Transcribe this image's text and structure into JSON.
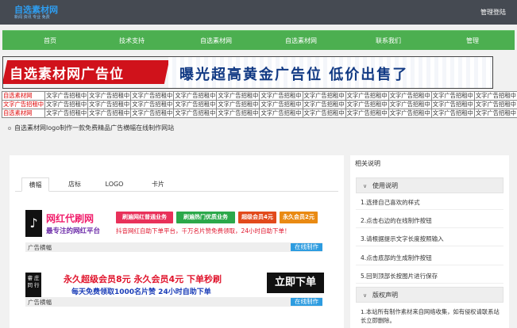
{
  "header": {
    "logo_main": "自选素材网",
    "logo_sub": "新闻 资讯 专业 免费",
    "login": "管理登陆"
  },
  "nav": {
    "items": [
      "首页",
      "技术支持",
      "自选素材网",
      "自选素材网",
      "联系我们",
      "管理"
    ]
  },
  "banner": {
    "left": "自选素材网广告位",
    "right": "曝光超高黄金广告位 低价出售了"
  },
  "ad_grid": {
    "rows": [
      [
        "自选素材网",
        "文字广告招租中",
        "文字广告招租中",
        "文字广告招租中",
        "文字广告招租中",
        "文字广告招租中",
        "文字广告招租中",
        "文字广告招租中",
        "文字广告招租中",
        "文字广告招租中",
        "文字广告招租中",
        "文字广告招租中"
      ],
      [
        "文字广告招租中",
        "文字广告招租中",
        "文字广告招租中",
        "文字广告招租中",
        "文字广告招租中",
        "文字广告招租中",
        "文字广告招租中",
        "文字广告招租中",
        "文字广告招租中",
        "文字广告招租中",
        "文字广告招租中",
        "文字广告招租中"
      ],
      [
        "自选素材网",
        "文字广告招租中",
        "文字广告招租中",
        "文字广告招租中",
        "文字广告招租中",
        "文字广告招租中",
        "文字广告招租中",
        "文字广告招租中",
        "文字广告招租中",
        "文字广告招租中",
        "文字广告招租中",
        "文字广告招租中"
      ]
    ]
  },
  "notice": "自选素材网logo制作一款免费精品广告横幅在线制作网站",
  "main": {
    "tabs": [
      "横幅",
      "店标",
      "LOGO",
      "卡片"
    ],
    "cards": [
      {
        "title": "网红代刷网",
        "subtitle": "最专注的网红平台",
        "tags": [
          "刷遍网红普通业务",
          "刷遍热门优质业务",
          "超级会员4元",
          "永久会员2元"
        ],
        "bottom": "抖音网红自助下单平台，千万名片赞免费领取，24小时自助下单！",
        "category": "广告横幅",
        "action": "在线制作"
      },
      {
        "left": "睿 庄 同 行",
        "title": "永久超级会员8元  永久会员4元  下单秒刷",
        "subtitle": "每天免费领取1000名片赞  24小时自助下单",
        "button": "立即下单",
        "category": "广告横幅",
        "action": "在线制作"
      }
    ]
  },
  "sidebar": {
    "title": "相关说明",
    "section1": "使用说明",
    "steps": [
      "1.选择自己喜欢的样式",
      "2.点击右边的在线制作按钮",
      "3.请根据提示文字长度按照输入",
      "4.点击底部的生成制作按钮",
      "5.回到顶部长按图片进行保存"
    ],
    "section2": "版权声明",
    "copyright": "1.本站所有制作素材来自网络收集，如有侵权请联系站长立即删除。"
  },
  "colors": {
    "topbar": "#454a52",
    "nav": "#4caf50",
    "accent_blue": "#2d9ce0",
    "banner_red": "#d0121b"
  }
}
